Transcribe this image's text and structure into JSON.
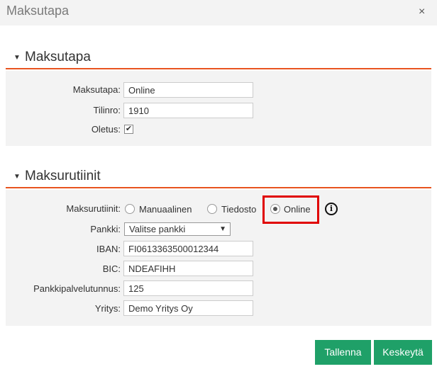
{
  "dialog": {
    "title": "Maksutapa",
    "close_glyph": "×"
  },
  "section1": {
    "title": "Maksutapa",
    "fields": {
      "maksutapa": {
        "label": "Maksutapa:",
        "value": "Online"
      },
      "tilinro": {
        "label": "Tilinro:",
        "value": "1910"
      },
      "oletus": {
        "label": "Oletus:",
        "checked": true,
        "check_glyph": "✔"
      }
    }
  },
  "section2": {
    "title": "Maksurutiinit",
    "maksurutiinit": {
      "label": "Maksurutiinit:",
      "options": [
        {
          "label": "Manuaalinen",
          "selected": false
        },
        {
          "label": "Tiedosto",
          "selected": false
        },
        {
          "label": "Online",
          "selected": true
        }
      ]
    },
    "pankki": {
      "label": "Pankki:",
      "selected": "Valitse pankki"
    },
    "iban": {
      "label": "IBAN:",
      "value": "FI0613363500012344"
    },
    "bic": {
      "label": "BIC:",
      "value": "NDEAFIHH"
    },
    "pankkipalvelutunnus": {
      "label": "Pankkipalvelutunnus:",
      "value": "125"
    },
    "yritys": {
      "label": "Yritys:",
      "value": "Demo Yritys Oy"
    }
  },
  "icons": {
    "collapse": "chevron-down-icon",
    "info": "info-icon",
    "info_glyph": "i"
  },
  "colors": {
    "accent": "#e8541f",
    "button": "#1fa068",
    "highlight": "#e00000",
    "panel": "#f3f3f3"
  },
  "buttons": {
    "save": "Tallenna",
    "cancel": "Keskeytä"
  }
}
